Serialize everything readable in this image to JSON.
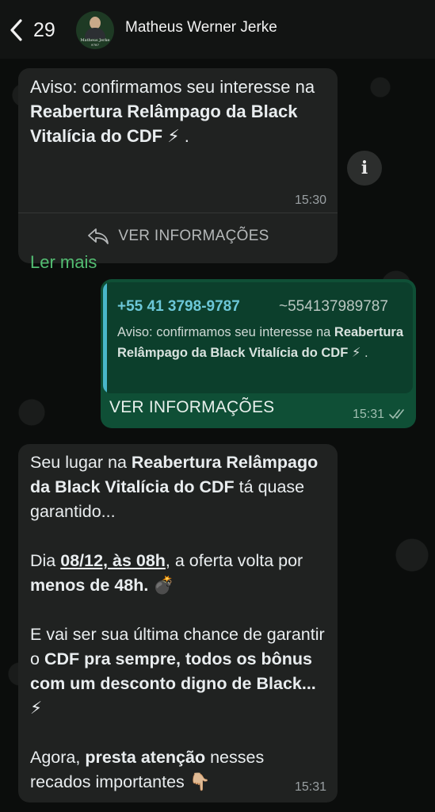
{
  "header": {
    "back_count": "29",
    "contact_name": "Matheus Werner Jerke",
    "avatar_line1": "Matheus Jerke",
    "avatar_line2": "9787"
  },
  "messages": [
    {
      "direction": "incoming",
      "text_parts": [
        "Aviso: confirmamos seu interesse na ",
        "Reabertura Relâmpago da Black Vitalícia do CDF",
        " ⚡ ."
      ],
      "read_more": "Ler mais",
      "time": "15:30",
      "action_label": "VER INFORMAÇÕES"
    },
    {
      "direction": "outgoing",
      "quote": {
        "phone": "+55 41 3798-9787",
        "alias": "~554137989787",
        "text_start": "Aviso: confirmamos seu interesse na ",
        "text_bold": "Reabertura Relâmpago da Black Vitalícia do CDF",
        "text_end": " ⚡ ."
      },
      "action_label": "VER INFORMAÇÕES",
      "time": "15:31",
      "status": "delivered"
    },
    {
      "direction": "incoming",
      "p1": [
        "Seu lugar na ",
        "Reabertura Relâmpago da Black Vitalícia do CDF",
        " tá quase garantido..."
      ],
      "p2": [
        "Dia ",
        "08/12, às 08h",
        ", a oferta volta por ",
        "menos de 48h.",
        " 💣"
      ],
      "p3": [
        "E vai ser sua última chance de garantir o ",
        "CDF pra sempre, todos os bônus com um desconto digno de Black...",
        " ⚡"
      ],
      "p4": [
        "Agora, ",
        "presta atenção",
        " nesses recados importantes 👇🏼"
      ],
      "time": "15:31"
    }
  ],
  "colors": {
    "accent_green": "#53bd72",
    "outgoing_bubble": "#0f4f36",
    "incoming_bubble": "#202221",
    "quote_bar": "#48b6c9"
  }
}
